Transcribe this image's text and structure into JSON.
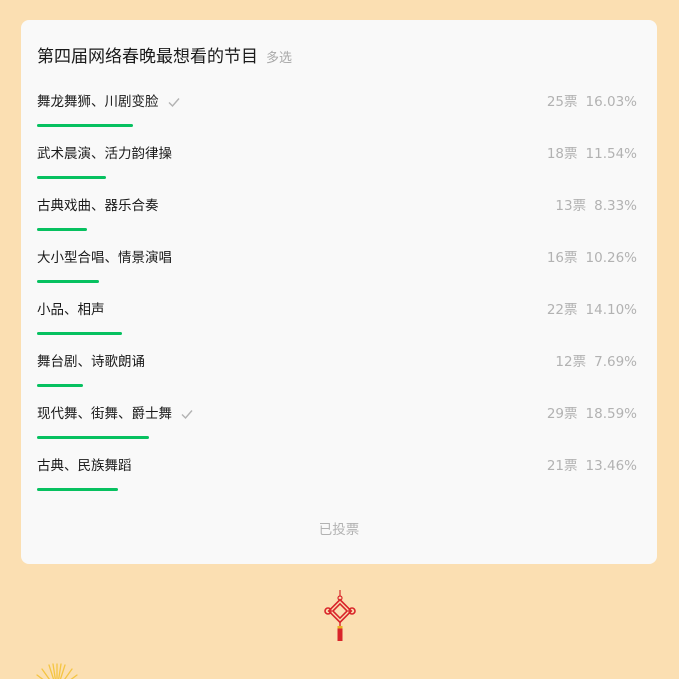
{
  "poll": {
    "title": "第四届网络春晚最想看的节目",
    "type_label": "多选",
    "options": [
      {
        "label": "舞龙舞狮、川剧变脸",
        "votes": "25票",
        "percent": "16.03%",
        "fraction": 0.1603,
        "selected": true
      },
      {
        "label": "武术晨演、活力韵律操",
        "votes": "18票",
        "percent": "11.54%",
        "fraction": 0.1154,
        "selected": false
      },
      {
        "label": "古典戏曲、器乐合奏",
        "votes": "13票",
        "percent": "8.33%",
        "fraction": 0.0833,
        "selected": false
      },
      {
        "label": "大小型合唱、情景演唱",
        "votes": "16票",
        "percent": "10.26%",
        "fraction": 0.1026,
        "selected": false
      },
      {
        "label": "小品、相声",
        "votes": "22票",
        "percent": "14.10%",
        "fraction": 0.141,
        "selected": false
      },
      {
        "label": "舞台剧、诗歌朗诵",
        "votes": "12票",
        "percent": "7.69%",
        "fraction": 0.0769,
        "selected": false
      },
      {
        "label": "现代舞、街舞、爵士舞",
        "votes": "29票",
        "percent": "18.59%",
        "fraction": 0.1859,
        "selected": true
      },
      {
        "label": "古典、民族舞蹈",
        "votes": "21票",
        "percent": "13.46%",
        "fraction": 0.1346,
        "selected": false
      }
    ],
    "footer_status": "已投票"
  },
  "colors": {
    "background": "#fbdfb2",
    "card": "#f9f9f9",
    "bar": "#07c160",
    "muted_text": "#b2b2b2",
    "knot": "#d9252a"
  },
  "decorations": {
    "knot_icon": "chinese-knot-icon",
    "sun_icon": "sun-rays-icon",
    "check_icon": "check-icon"
  }
}
